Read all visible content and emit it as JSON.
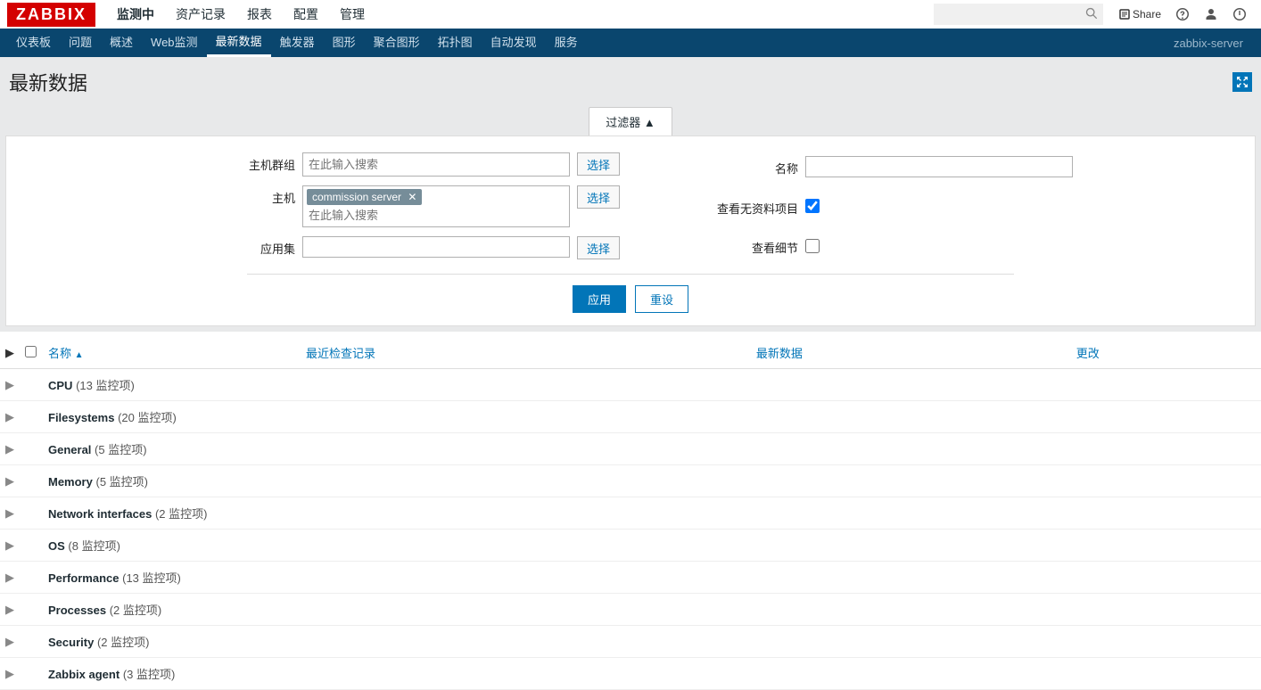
{
  "logo": "ZABBIX",
  "topnav": {
    "items": [
      "监测中",
      "资产记录",
      "报表",
      "配置",
      "管理"
    ],
    "active": 0,
    "share": "Share"
  },
  "subnav": {
    "items": [
      "仪表板",
      "问题",
      "概述",
      "Web监测",
      "最新数据",
      "触发器",
      "图形",
      "聚合图形",
      "拓扑图",
      "自动发现",
      "服务"
    ],
    "active": 4,
    "right": "zabbix-server"
  },
  "page": {
    "title": "最新数据"
  },
  "filter": {
    "tab": "过滤器 ▲",
    "hostgroups_label": "主机群组",
    "hostgroups_placeholder": "在此输入搜索",
    "hosts_label": "主机",
    "hosts_tag": "commission server",
    "hosts_placeholder": "在此输入搜索",
    "application_label": "应用集",
    "select_btn": "选择",
    "name_label": "名称",
    "show_without_data_label": "查看无资料项目",
    "show_details_label": "查看细节",
    "show_without_data_checked": true,
    "show_details_checked": false,
    "apply_btn": "应用",
    "reset_btn": "重设"
  },
  "table": {
    "headers": {
      "name": "名称",
      "last_check": "最近检查记录",
      "last_value": "最新数据",
      "change": "更改"
    },
    "rows": [
      {
        "name": "CPU",
        "count": "(13 监控项)"
      },
      {
        "name": "Filesystems",
        "count": "(20 监控项)"
      },
      {
        "name": "General",
        "count": "(5 监控项)"
      },
      {
        "name": "Memory",
        "count": "(5 监控项)"
      },
      {
        "name": "Network interfaces",
        "count": "(2 监控项)"
      },
      {
        "name": "OS",
        "count": "(8 监控项)"
      },
      {
        "name": "Performance",
        "count": "(13 监控项)"
      },
      {
        "name": "Processes",
        "count": "(2 监控项)"
      },
      {
        "name": "Security",
        "count": "(2 监控项)"
      },
      {
        "name": "Zabbix agent",
        "count": "(3 监控项)"
      }
    ]
  }
}
